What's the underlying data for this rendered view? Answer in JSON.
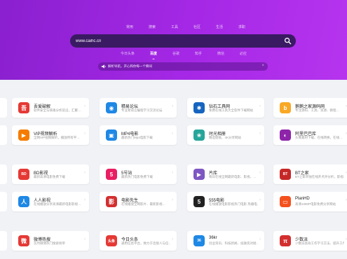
{
  "topnav": [
    "常用",
    "搜索",
    "工具",
    "社区",
    "生活",
    "求职"
  ],
  "search": {
    "value": "www.caihc.cn"
  },
  "engines": [
    "今日头条",
    "百度",
    "谷歌",
    "知乎",
    "微信",
    "必应"
  ],
  "active_engine": "百度",
  "notice": {
    "text": "解析导航，开心和你每一个瞬间"
  },
  "rows": [
    [
      {
        "title": "吾爱破解",
        "desc": "软件安全与病毒分析前沿，汇聚…",
        "icon": "52pojie-icon",
        "color": "#e53935",
        "glyph": "吾"
      },
      {
        "title": "精易论坛",
        "desc": "专业易语言编程学习交流论坛",
        "icon": "eye-icon",
        "color": "#1e88e5",
        "glyph": "◉"
      },
      {
        "title": "钻石工具网",
        "desc": "免费在线工具大全软件下载网站",
        "icon": "diamond-tool-icon",
        "color": "#1565c0",
        "glyph": "✱"
      },
      {
        "title": "鹅鹅之家源码网",
        "desc": "专注源码、工具、资源、教程…",
        "icon": "ee-home-icon",
        "color": "#f9a825",
        "glyph": "b"
      }
    ],
    [
      {
        "title": "VIP视频解析",
        "desc": "全网VIP视频解析，播放所有平…",
        "icon": "vip-video-icon",
        "color": "#f57c00",
        "glyph": "▶"
      },
      {
        "title": "MP4电影",
        "desc": "最新热门Mp4电影下载",
        "icon": "mp4-movie-icon",
        "color": "#1e88e5",
        "glyph": "▣"
      },
      {
        "title": "时光相册",
        "desc": "精选壁纸、4K分享网站",
        "icon": "album-icon",
        "color": "#26a69a",
        "glyph": "❀"
      },
      {
        "title": "阿里巴巴库",
        "desc": "头像素材下载、在线转换，在线…",
        "icon": "alibaba-icon",
        "color": "#8e24aa",
        "glyph": "◐"
      }
    ],
    [
      {
        "title": "BD影视",
        "desc": "最新高清电影免费下载",
        "icon": "bd-movie-icon",
        "color": "#e53935",
        "glyph": "BD"
      },
      {
        "title": "5号站",
        "desc": "最新热门电影免费下载",
        "icon": "five-icon",
        "color": "#e91e63",
        "glyph": "5"
      },
      {
        "title": "片库",
        "desc": "每日在线全网最新电影、影视、…",
        "icon": "pianku-icon",
        "color": "#7e57c2",
        "glyph": "▶"
      },
      {
        "title": "BT之家",
        "desc": "BT之家单独在线开点评分析，影视…",
        "icon": "bt-home-icon",
        "color": "#c62828",
        "glyph": "BT"
      }
    ],
    [
      {
        "title": "人人影视",
        "desc": "在线播放分享高清最新电影影视…",
        "icon": "renren-icon",
        "color": "#1e88e5",
        "glyph": "人"
      },
      {
        "title": "电影先生",
        "desc": "在线播放全网影片、最新影视…",
        "icon": "movie-mr-icon",
        "color": "#d32f2f",
        "glyph": "影"
      },
      {
        "title": "555电影",
        "desc": "在线播放电影影视热门电影 热播电…",
        "icon": "555-movie-icon",
        "color": "#212121",
        "glyph": "5"
      },
      {
        "title": "PlanHD",
        "desc": "高清1080P电影免费分享网站",
        "icon": "planhd-icon",
        "color": "#f4511e",
        "glyph": "▭"
      }
    ],
    [
      {
        "title": "微博热搜",
        "desc": "实时微博热门搜索榜单",
        "icon": "weibo-icon",
        "color": "#e53935",
        "glyph": "微"
      },
      {
        "title": "今日头条",
        "desc": "通用信息平台，致力于连接人与信…",
        "icon": "toutiao-icon",
        "color": "#e53935",
        "glyph": "头条"
      },
      {
        "title": "36kr",
        "desc": "创业资讯、科技新闻、投融资对接…",
        "icon": "36kr-icon",
        "color": "#1e88e5",
        "glyph": "36"
      },
      {
        "title": "少数派",
        "desc": "少数派高效工作学习方法、提升工作…",
        "icon": "sspai-icon",
        "color": "#d32f2f",
        "glyph": "π"
      }
    ]
  ]
}
